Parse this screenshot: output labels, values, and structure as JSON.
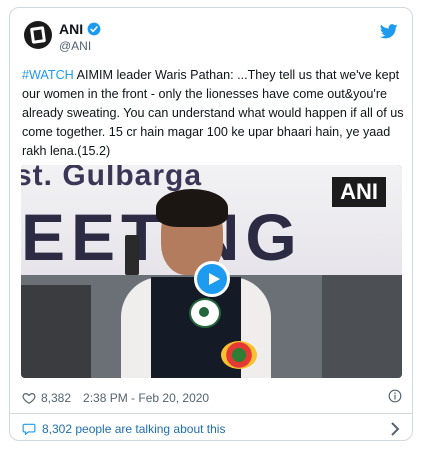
{
  "account": {
    "name": "ANI",
    "handle": "@ANI"
  },
  "tweet": {
    "hashtag": "#WATCH",
    "body": " AIMIM leader Waris Pathan: ...They tell us that we've kept our women in the front - only the lionesses have come out&you're already sweating. You can understand what would happen if all of us come together. 15 cr hain magar 100 ke upar bhaari hain, ye yaad rakh lena.(15.2)"
  },
  "media": {
    "banner_line1": "st. Gulbarga",
    "banner_line2": "EETING",
    "watermark": "ANI"
  },
  "meta": {
    "likes": "8,382",
    "timestamp": "2:38 PM - Feb 20, 2020"
  },
  "footer": {
    "talking": "8,302 people are talking about this"
  },
  "colors": {
    "accent": "#1d9bf0",
    "text": "#0f1419",
    "muted": "#536471"
  },
  "icons": {
    "verified": "verified-badge-icon",
    "bird": "twitter-bird-icon",
    "heart": "heart-icon",
    "info": "info-icon",
    "bubble": "speech-bubble-icon",
    "chevron": "chevron-right-icon",
    "play": "play-icon"
  }
}
